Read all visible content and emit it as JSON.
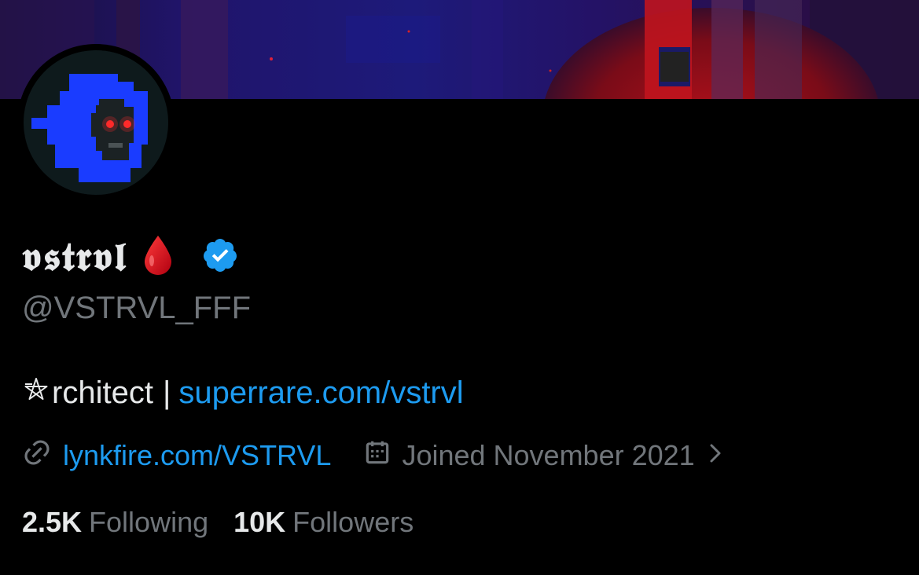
{
  "profile": {
    "display_name": "𝖛𝖘𝖙𝖗𝖛𝖑",
    "handle": "@VSTRVL_FFF",
    "verified": true,
    "bio": {
      "prefix": "rchitect",
      "separator": "|",
      "link": "superrare.com/vstrvl"
    },
    "website": "lynkfire.com/VSTRVL",
    "joined": "Joined November 2021",
    "following_count": "2.5K",
    "following_label": "Following",
    "followers_count": "10K",
    "followers_label": "Followers"
  },
  "icons": {
    "name_emoji": "drop-of-blood-icon",
    "verified": "verified-badge-icon",
    "bio_prefix": "pentagram-icon",
    "website": "link-icon",
    "joined": "calendar-icon",
    "joined_more": "chevron-right-icon"
  },
  "colors": {
    "background": "#000000",
    "primary_text": "#e7e9ea",
    "secondary_text": "#71767b",
    "link": "#1d9bf0",
    "verified": "#1d9bf0",
    "avatar_blue": "#1a3cff",
    "blood_red": "#d0101c"
  }
}
